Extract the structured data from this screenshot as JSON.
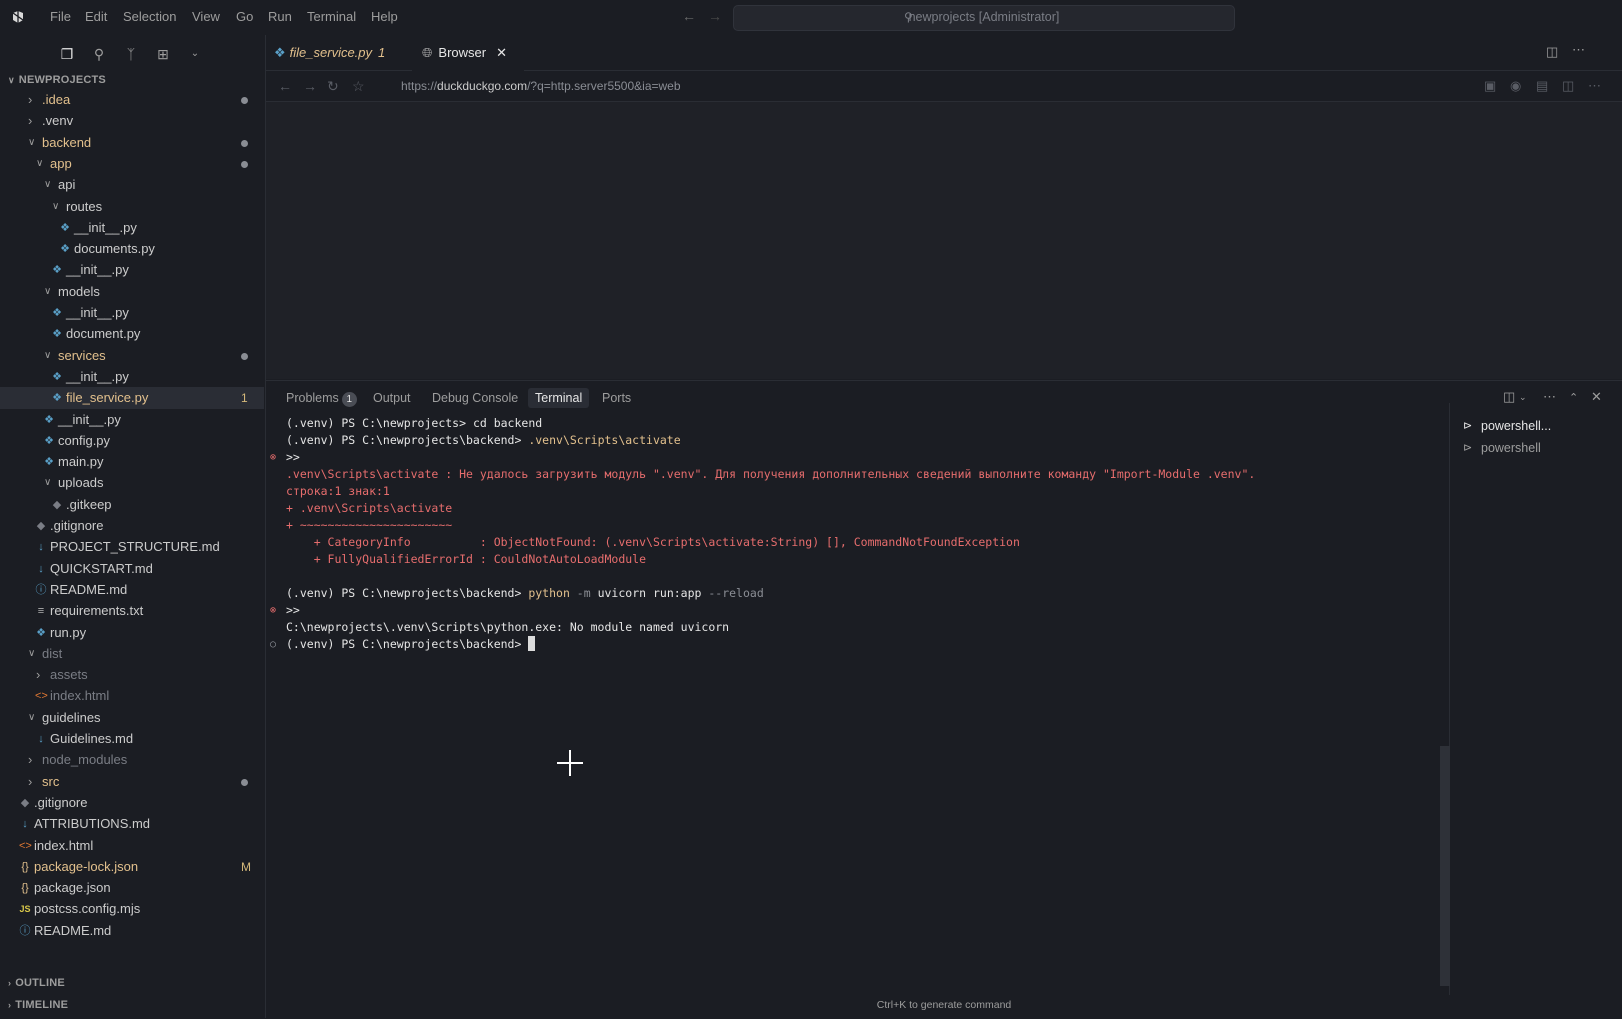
{
  "titlebar": {
    "menu": [
      "File",
      "Edit",
      "Selection",
      "View",
      "Go",
      "Run",
      "Terminal",
      "Help"
    ],
    "search": "newprojects [Administrator]"
  },
  "sidebar": {
    "root": "NEWPROJECTS",
    "items": [
      {
        "label": ".idea",
        "kind": "folder",
        "state": "closed",
        "color": "mod",
        "dot": true,
        "icon": ""
      },
      {
        "label": ".venv",
        "kind": "folder",
        "state": "closed",
        "color": "norm",
        "dot": false,
        "icon": ""
      },
      {
        "label": "backend",
        "kind": "folder",
        "state": "open",
        "color": "mod",
        "dot": true,
        "icon": ""
      },
      {
        "label": "app",
        "kind": "folder",
        "state": "open",
        "color": "mod",
        "dot": true,
        "icon": ""
      },
      {
        "label": "api",
        "kind": "folder",
        "state": "open",
        "color": "norm",
        "dot": false,
        "icon": ""
      },
      {
        "label": "routes",
        "kind": "folder",
        "state": "open",
        "color": "norm",
        "dot": false,
        "icon": ""
      },
      {
        "label": "__init__.py",
        "kind": "file",
        "color": "norm",
        "icon": "python-icon"
      },
      {
        "label": "documents.py",
        "kind": "file",
        "color": "norm",
        "icon": "python-icon"
      },
      {
        "label": "__init__.py",
        "kind": "file",
        "color": "norm",
        "icon": "python-icon"
      },
      {
        "label": "models",
        "kind": "folder",
        "state": "open",
        "color": "norm",
        "dot": false,
        "icon": ""
      },
      {
        "label": "__init__.py",
        "kind": "file",
        "color": "norm",
        "icon": "python-icon"
      },
      {
        "label": "document.py",
        "kind": "file",
        "color": "norm",
        "icon": "python-icon"
      },
      {
        "label": "services",
        "kind": "folder",
        "state": "open",
        "color": "mod",
        "dot": true,
        "icon": ""
      },
      {
        "label": "__init__.py",
        "kind": "file",
        "color": "norm",
        "icon": "python-icon"
      },
      {
        "label": "file_service.py",
        "kind": "file",
        "color": "mod",
        "icon": "python-icon",
        "badge": "1",
        "selected": true
      },
      {
        "label": "__init__.py",
        "kind": "file",
        "color": "norm",
        "icon": "python-icon"
      },
      {
        "label": "config.py",
        "kind": "file",
        "color": "norm",
        "icon": "python-icon"
      },
      {
        "label": "main.py",
        "kind": "file",
        "color": "norm",
        "icon": "python-icon"
      },
      {
        "label": "uploads",
        "kind": "folder",
        "state": "open",
        "color": "norm",
        "dot": false,
        "icon": ""
      },
      {
        "label": ".gitkeep",
        "kind": "file",
        "color": "norm",
        "icon": "git-icon"
      },
      {
        "label": ".gitignore",
        "kind": "file",
        "color": "norm",
        "icon": "git-icon"
      },
      {
        "label": "PROJECT_STRUCTURE.md",
        "kind": "file",
        "color": "norm",
        "icon": "markdown-icon"
      },
      {
        "label": "QUICKSTART.md",
        "kind": "file",
        "color": "norm",
        "icon": "markdown-icon"
      },
      {
        "label": "README.md",
        "kind": "file",
        "color": "norm",
        "icon": "info-icon"
      },
      {
        "label": "requirements.txt",
        "kind": "file",
        "color": "norm",
        "icon": "text-icon"
      },
      {
        "label": "run.py",
        "kind": "file",
        "color": "norm",
        "icon": "python-icon"
      },
      {
        "label": "dist",
        "kind": "folder",
        "state": "open",
        "color": "dim",
        "dot": false,
        "icon": ""
      },
      {
        "label": "assets",
        "kind": "folder",
        "state": "closed",
        "color": "dim",
        "dot": false,
        "icon": ""
      },
      {
        "label": "index.html",
        "kind": "file",
        "color": "dim",
        "icon": "html-icon"
      },
      {
        "label": "guidelines",
        "kind": "folder",
        "state": "open",
        "color": "norm",
        "dot": false,
        "icon": ""
      },
      {
        "label": "Guidelines.md",
        "kind": "file",
        "color": "norm",
        "icon": "markdown-icon"
      },
      {
        "label": "node_modules",
        "kind": "folder",
        "state": "closed",
        "color": "dim",
        "dot": false,
        "icon": ""
      },
      {
        "label": "src",
        "kind": "folder",
        "state": "closed",
        "color": "mod",
        "dot": true,
        "icon": ""
      },
      {
        "label": ".gitignore",
        "kind": "file",
        "color": "norm",
        "icon": "git-icon"
      },
      {
        "label": "ATTRIBUTIONS.md",
        "kind": "file",
        "color": "norm",
        "icon": "markdown-icon"
      },
      {
        "label": "index.html",
        "kind": "file",
        "color": "norm",
        "icon": "html-icon"
      },
      {
        "label": "package-lock.json",
        "kind": "file",
        "color": "mod",
        "icon": "json-icon",
        "badge": "M"
      },
      {
        "label": "package.json",
        "kind": "file",
        "color": "norm",
        "icon": "json-icon"
      },
      {
        "label": "postcss.config.mjs",
        "kind": "file",
        "color": "norm",
        "icon": "js-icon"
      },
      {
        "label": "README.md",
        "kind": "file",
        "color": "norm",
        "icon": "info-icon"
      }
    ],
    "outline": "OUTLINE",
    "timeline": "TIMELINE"
  },
  "tabs": {
    "file": {
      "label": "file_service.py",
      "problems": "1"
    },
    "browser": {
      "label": "Browser"
    }
  },
  "browser": {
    "url_prefix": "https://",
    "url_host": "duckduckgo.com",
    "url_path": "/?q=http.server5500&ia=web"
  },
  "panel": {
    "tabs": {
      "problems": "Problems",
      "problems_count": "1",
      "output": "Output",
      "debug": "Debug Console",
      "terminal": "Terminal",
      "ports": "Ports"
    },
    "terminal_lines": [
      {
        "gutter": "",
        "segments": [
          {
            "t": "(.venv) PS C:\\newprojects> ",
            "c": "white"
          },
          {
            "t": "cd backend",
            "c": "white"
          }
        ]
      },
      {
        "gutter": "",
        "segments": [
          {
            "t": "(.venv) PS C:\\newprojects\\backend> ",
            "c": "white"
          },
          {
            "t": ".venv\\Scripts\\activate",
            "c": "yellow"
          }
        ]
      },
      {
        "gutter": "err",
        "segments": [
          {
            "t": ">>",
            "c": "white"
          }
        ]
      },
      {
        "gutter": "",
        "segments": [
          {
            "t": ".venv\\Scripts\\activate : Не удалось загрузить модуль \".venv\". Для получения дополнительных сведений выполните команду \"Import-Module .venv\".",
            "c": "red"
          }
        ]
      },
      {
        "gutter": "",
        "segments": [
          {
            "t": "строка:1 знак:1",
            "c": "red"
          }
        ]
      },
      {
        "gutter": "",
        "segments": [
          {
            "t": "+ .venv\\Scripts\\activate",
            "c": "red"
          }
        ]
      },
      {
        "gutter": "",
        "segments": [
          {
            "t": "+ ~~~~~~~~~~~~~~~~~~~~~~",
            "c": "red"
          }
        ]
      },
      {
        "gutter": "",
        "segments": [
          {
            "t": "    + CategoryInfo          : ObjectNotFound: (.venv\\Scripts\\activate:String) [], CommandNotFoundException",
            "c": "red"
          }
        ]
      },
      {
        "gutter": "",
        "segments": [
          {
            "t": "    + FullyQualifiedErrorId : CouldNotAutoLoadModule",
            "c": "red"
          }
        ]
      },
      {
        "gutter": "",
        "segments": [
          {
            "t": " ",
            "c": "white"
          }
        ]
      },
      {
        "gutter": "",
        "segments": [
          {
            "t": "(.venv) PS C:\\newprojects\\backend> ",
            "c": "white"
          },
          {
            "t": "python",
            "c": "yellow"
          },
          {
            "t": " -m ",
            "c": "gray"
          },
          {
            "t": "uvicorn run:app ",
            "c": "white"
          },
          {
            "t": "--reload",
            "c": "gray"
          }
        ]
      },
      {
        "gutter": "err",
        "segments": [
          {
            "t": ">>",
            "c": "white"
          }
        ]
      },
      {
        "gutter": "",
        "segments": [
          {
            "t": "C:\\newprojects\\.venv\\Scripts\\python.exe: No module named uvicorn",
            "c": "white"
          }
        ]
      },
      {
        "gutter": "ok",
        "segments": [
          {
            "t": "(.venv) PS C:\\newprojects\\backend> ",
            "c": "white"
          }
        ],
        "cursor": true
      }
    ],
    "terminals": [
      "powershell...",
      "powershell"
    ],
    "hint": "Ctrl+K to generate command"
  }
}
